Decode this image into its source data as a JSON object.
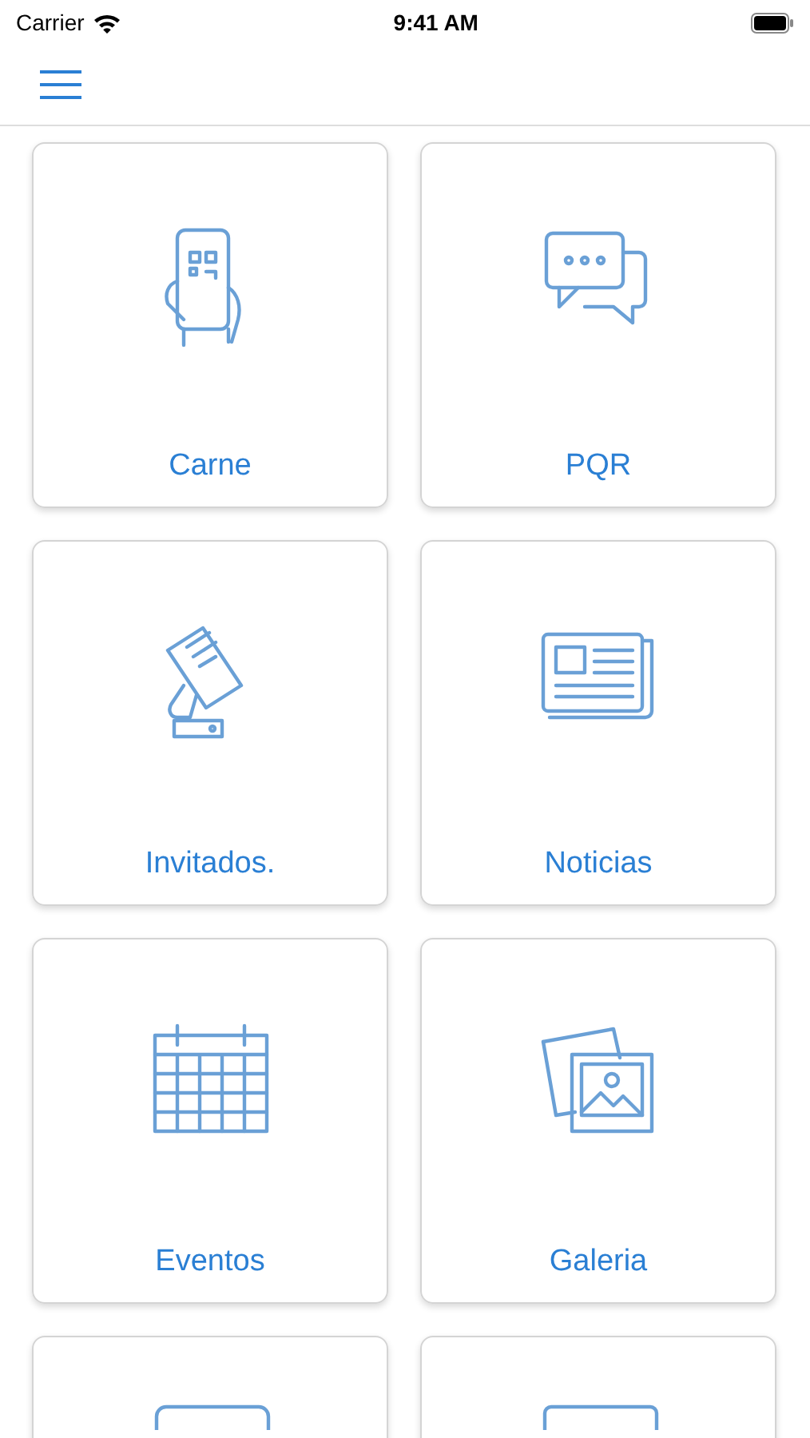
{
  "status_bar": {
    "carrier": "Carrier",
    "time": "9:41 AM"
  },
  "tiles": [
    {
      "label": "Carne"
    },
    {
      "label": "PQR"
    },
    {
      "label": "Invitados."
    },
    {
      "label": "Noticias"
    },
    {
      "label": "Eventos"
    },
    {
      "label": "Galeria"
    },
    {
      "kind": "cut"
    },
    {
      "kind": "cut"
    }
  ]
}
